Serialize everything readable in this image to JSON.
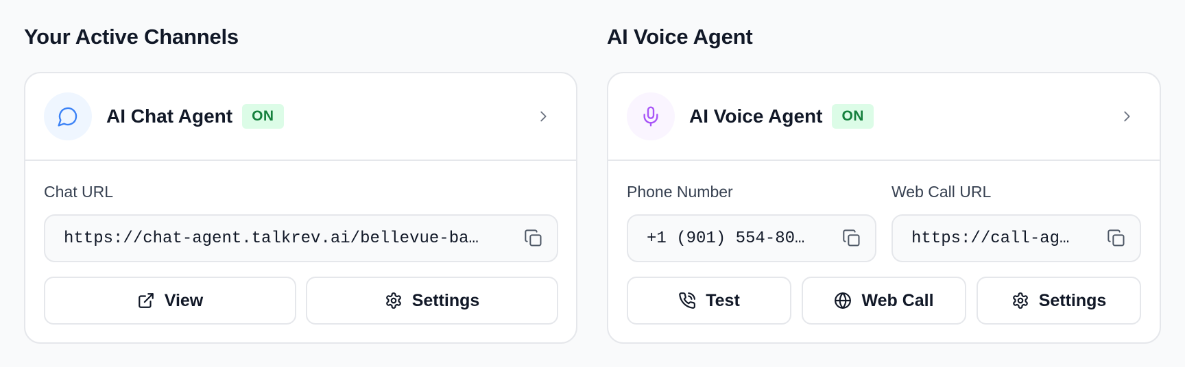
{
  "channels_section": {
    "title": "Your Active Channels",
    "chat_agent": {
      "name": "AI Chat Agent",
      "status": "ON",
      "icon": "chat-bubble-icon",
      "chevron_icon": "chevron-right-icon",
      "url_label": "Chat URL",
      "url_value": "https://chat-agent.talkrev.ai/bellevue-ba…",
      "copy_icon": "copy-icon",
      "buttons": {
        "view": {
          "label": "View",
          "icon": "external-link-icon"
        },
        "settings": {
          "label": "Settings",
          "icon": "gear-icon"
        }
      }
    }
  },
  "voice_section": {
    "title": "AI Voice Agent",
    "voice_agent": {
      "name": "AI Voice Agent",
      "status": "ON",
      "icon": "microphone-icon",
      "chevron_icon": "chevron-right-icon",
      "phone_label": "Phone Number",
      "phone_value": "+1 (901) 554-80…",
      "web_call_label": "Web Call URL",
      "web_call_value": "https://call-ag…",
      "copy_icon": "copy-icon",
      "buttons": {
        "test": {
          "label": "Test",
          "icon": "phone-icon"
        },
        "web_call": {
          "label": "Web Call",
          "icon": "globe-icon"
        },
        "settings": {
          "label": "Settings",
          "icon": "gear-icon"
        }
      }
    }
  },
  "colors": {
    "badge_bg": "#dcfce7",
    "badge_text": "#15803d",
    "chat_icon": "#3b82f6",
    "voice_icon": "#a855f7",
    "border": "#e5e7eb",
    "page_bg": "#f9fafb"
  }
}
